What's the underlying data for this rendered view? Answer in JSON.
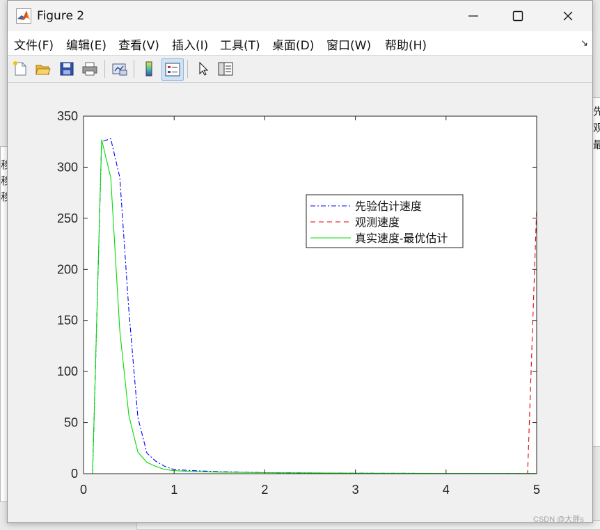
{
  "window": {
    "title": "Figure 2",
    "controls": {
      "minimize": "—",
      "maximize": "☐",
      "close": "✕"
    }
  },
  "menubar": {
    "items": [
      "文件(F)",
      "编辑(E)",
      "查看(V)",
      "插入(I)",
      "工具(T)",
      "桌面(D)",
      "窗口(W)",
      "帮助(H)"
    ],
    "expand_icon": "↘"
  },
  "toolbar": {
    "icons": [
      "new-figure-icon",
      "open-file-icon",
      "save-icon",
      "print-icon",
      "link-plot-icon",
      "colorbar-icon",
      "legend-icon",
      "pointer-icon",
      "property-editor-icon"
    ]
  },
  "background_windows": {
    "left_labels": [
      "移",
      "移",
      "移"
    ],
    "right_labels": [
      "先",
      "观",
      "最"
    ]
  },
  "chart_data": {
    "type": "line",
    "title": "",
    "xlabel": "",
    "ylabel": "",
    "xlim": [
      0,
      5
    ],
    "ylim": [
      0,
      350
    ],
    "xticks": [
      0,
      1,
      2,
      3,
      4,
      5
    ],
    "yticks": [
      0,
      50,
      100,
      150,
      200,
      250,
      300,
      350
    ],
    "grid": false,
    "legend_position": "top-right",
    "series": [
      {
        "name": "先验估计速度",
        "style": "dashdot",
        "color": "#0000ff",
        "x": [
          0.1,
          0.2,
          0.3,
          0.4,
          0.5,
          0.6,
          0.7,
          0.8,
          0.9,
          1.0,
          1.2,
          1.5,
          2.0,
          3.0,
          4.0,
          5.0
        ],
        "y": [
          0,
          325,
          328,
          290,
          160,
          55,
          20,
          12,
          7,
          4,
          3,
          2,
          1,
          0.5,
          0.3,
          0.2
        ]
      },
      {
        "name": "观测速度",
        "style": "dashed",
        "color": "#e00000",
        "x": [
          0,
          1,
          2,
          3,
          4,
          4.9,
          5.0
        ],
        "y": [
          0,
          0,
          0,
          0,
          0,
          0,
          260
        ]
      },
      {
        "name": "真实速度-最优估计",
        "style": "solid",
        "color": "#00dd00",
        "x": [
          0.1,
          0.2,
          0.3,
          0.4,
          0.5,
          0.6,
          0.7,
          0.8,
          0.9,
          1.0,
          1.2,
          1.5,
          2.0,
          3.0,
          4.0,
          5.0
        ],
        "y": [
          0,
          327,
          290,
          140,
          57,
          21,
          11,
          7,
          4,
          3,
          2,
          1.5,
          1,
          0.5,
          0.3,
          0.2
        ]
      }
    ]
  },
  "watermark": "CSDN @大胖s"
}
